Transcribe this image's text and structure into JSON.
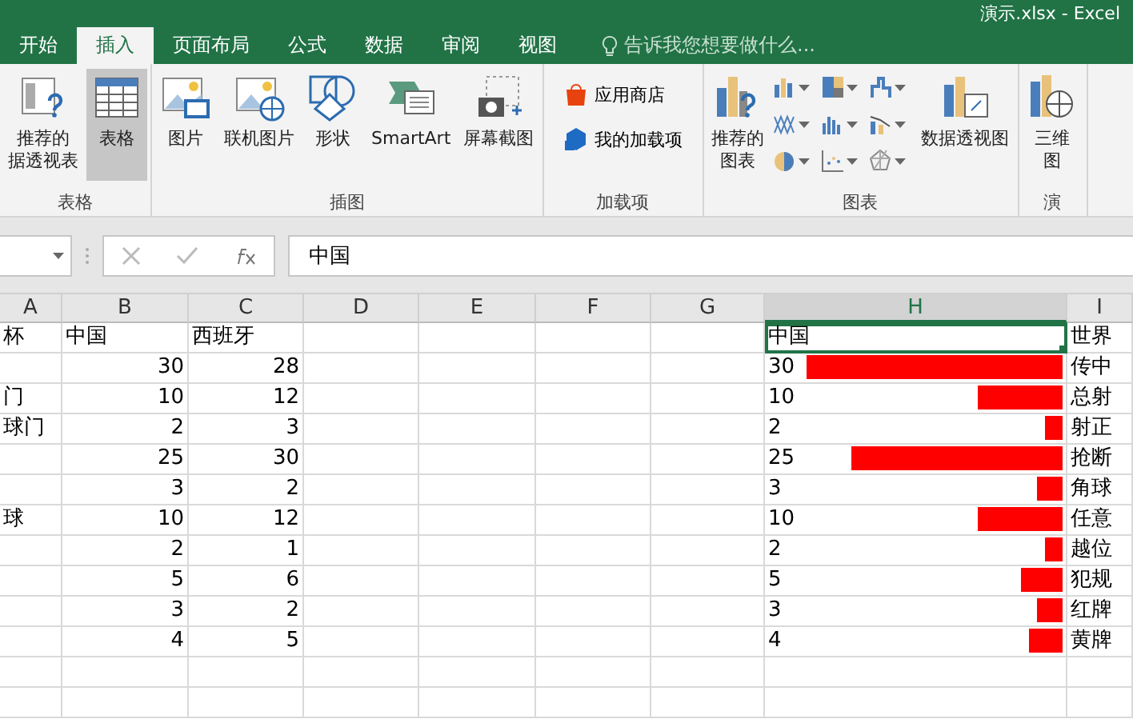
{
  "window": {
    "title": "演示.xlsx - Excel"
  },
  "tabs": [
    {
      "label": "开始",
      "selected": false
    },
    {
      "label": "插入",
      "selected": true
    },
    {
      "label": "页面布局",
      "selected": false
    },
    {
      "label": "公式",
      "selected": false
    },
    {
      "label": "数据",
      "selected": false
    },
    {
      "label": "审阅",
      "selected": false
    },
    {
      "label": "视图",
      "selected": false
    }
  ],
  "tell_me": {
    "placeholder": "告诉我您想要做什么..."
  },
  "ribbon": [
    {
      "label": "表格",
      "buttons": [
        {
          "lines": [
            "推荐的",
            "据透视表"
          ],
          "pressed": false
        },
        {
          "lines": [
            "表格"
          ],
          "pressed": true
        }
      ]
    },
    {
      "label": "插图",
      "buttons": [
        {
          "lines": [
            "图片"
          ],
          "pressed": false
        },
        {
          "lines": [
            "联机图片"
          ],
          "pressed": false
        },
        {
          "lines": [
            "形状"
          ],
          "pressed": false
        },
        {
          "lines": [
            "SmartArt"
          ],
          "pressed": false
        },
        {
          "lines": [
            "屏幕截图"
          ],
          "pressed": false
        }
      ]
    },
    {
      "label": "加载项",
      "small_buttons": [
        "应用商店",
        "我的加载项"
      ]
    },
    {
      "label": "图表",
      "buttons": [
        {
          "lines": [
            "推荐的",
            "图表"
          ],
          "pressed": false
        },
        {
          "lines": [
            "数据透视图"
          ],
          "pressed": false
        }
      ]
    },
    {
      "label": "演",
      "buttons": [
        {
          "lines": [
            "三维",
            "图"
          ],
          "pressed": false
        }
      ]
    }
  ],
  "formula_bar": {
    "value": "中国"
  },
  "columns": [
    {
      "label": "A",
      "selected": false
    },
    {
      "label": "B",
      "selected": false
    },
    {
      "label": "C",
      "selected": false
    },
    {
      "label": "D",
      "selected": false
    },
    {
      "label": "E",
      "selected": false
    },
    {
      "label": "F",
      "selected": false
    },
    {
      "label": "G",
      "selected": false
    },
    {
      "label": "H",
      "selected": true
    },
    {
      "label": "I",
      "selected": false
    }
  ],
  "rows": [
    {
      "a": "杯",
      "b": "中国",
      "c": "西班牙",
      "h": "中国",
      "i": "世界",
      "selected": true
    },
    {
      "a": "",
      "b": "30",
      "c": "28",
      "h": "30",
      "level": 0.85,
      "i": "传中",
      "selected": false
    },
    {
      "a": "门",
      "b": "10",
      "c": "12",
      "h": "10",
      "level": 0.28,
      "i": "总射",
      "selected": false
    },
    {
      "a": "球门",
      "b": "2",
      "c": "3",
      "h": "2",
      "level": 0.06,
      "i": "射正",
      "selected": false
    },
    {
      "a": "",
      "b": "25",
      "c": "30",
      "h": "25",
      "level": 0.7,
      "i": "抢断",
      "selected": false
    },
    {
      "a": "",
      "b": "3",
      "c": "2",
      "h": "3",
      "level": 0.085,
      "i": "角球",
      "selected": false
    },
    {
      "a": "球",
      "b": "10",
      "c": "12",
      "h": "10",
      "level": 0.28,
      "i": "任意",
      "selected": false
    },
    {
      "a": "",
      "b": "2",
      "c": "1",
      "h": "2",
      "level": 0.06,
      "i": "越位",
      "selected": false
    },
    {
      "a": "",
      "b": "5",
      "c": "6",
      "h": "5",
      "level": 0.14,
      "i": "犯规",
      "selected": false
    },
    {
      "a": "",
      "b": "3",
      "c": "2",
      "h": "3",
      "level": 0.085,
      "i": "红牌",
      "selected": false
    },
    {
      "a": "",
      "b": "4",
      "c": "5",
      "h": "4",
      "level": 0.11,
      "i": "黄牌",
      "selected": false
    }
  ]
}
